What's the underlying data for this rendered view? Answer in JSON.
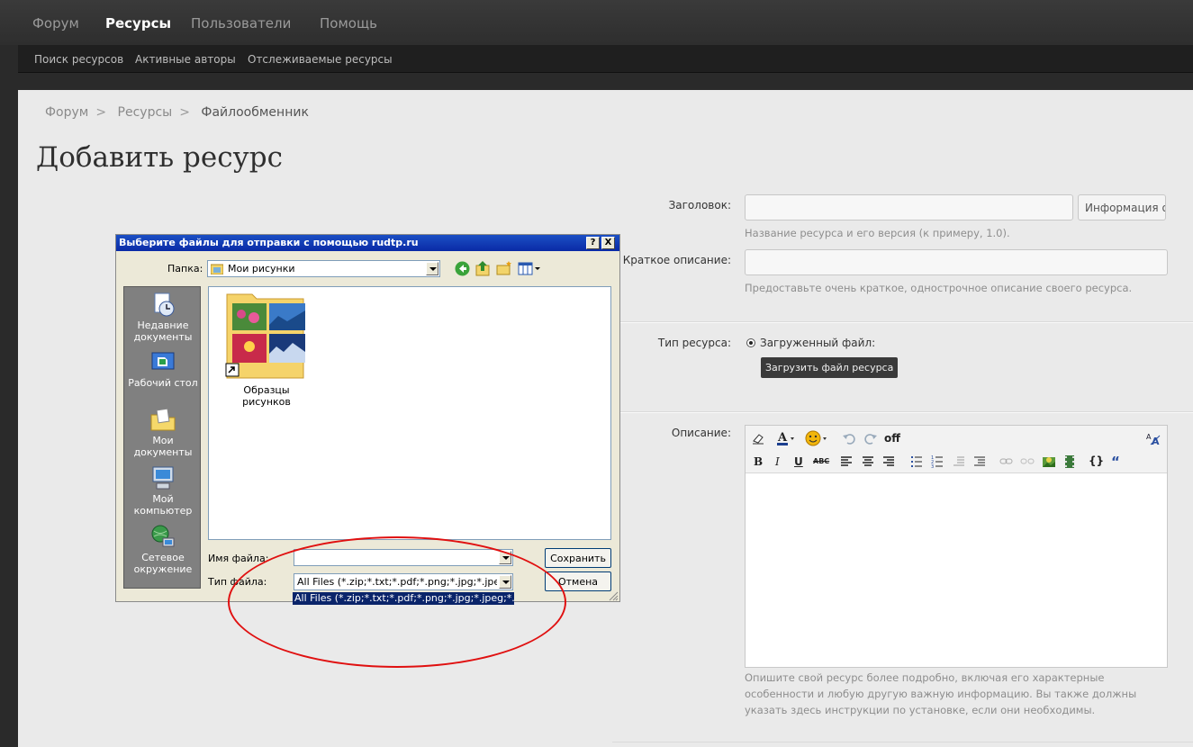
{
  "nav": {
    "tabs": [
      {
        "label": "Форум"
      },
      {
        "label": "Ресурсы"
      },
      {
        "label": "Пользователи"
      },
      {
        "label": "Помощь"
      }
    ],
    "subtabs": [
      {
        "label": "Поиск ресурсов"
      },
      {
        "label": "Активные авторы"
      },
      {
        "label": "Отслеживаемые ресурсы"
      }
    ]
  },
  "breadcrumb": [
    "Форум",
    "Ресурсы",
    "Файлообменник"
  ],
  "page_title": "Добавить ресурс",
  "form": {
    "title_label": "Заголовок:",
    "title_hint": "Название ресурса и его версия (к примеру, 1.0).",
    "info_button": "Информация о",
    "short_label": "Краткое описание:",
    "short_hint": "Предоставьте очень краткое, однострочное описание своего ресурса.",
    "type_label": "Тип ресурса:",
    "type_option": "Загруженный файл:",
    "upload_button": "Загрузить файл ресурса",
    "desc_label": "Описание:",
    "desc_hint": "Опишите свой ресурс более подробно, включая его характерные особенности и любую другую важную информацию. Вы также должны указать здесь инструкции по установке, если они необходимы.",
    "editor_off": "off"
  },
  "dialog": {
    "title": "Выберите файлы для отправки с помощью rudtp.ru",
    "help_btn": "?",
    "close_btn": "X",
    "folder_label": "Папка:",
    "folder_value": "Мои рисунки",
    "places": [
      {
        "label": "Недавние документы",
        "icon": "recent-documents-icon"
      },
      {
        "label": "Рабочий стол",
        "icon": "desktop-icon"
      },
      {
        "label": "Мои документы",
        "icon": "my-documents-icon"
      },
      {
        "label": "Мой компьютер",
        "icon": "my-computer-icon"
      },
      {
        "label": "Сетевое окружение",
        "icon": "network-icon"
      }
    ],
    "files": [
      {
        "label": "Образцы рисунков",
        "icon": "sample-pictures-folder-icon"
      }
    ],
    "filename_label": "Имя файла:",
    "filename_value": "",
    "filetype_label": "Тип файла:",
    "filetype_value": "All Files (*.zip;*.txt;*.pdf;*.png;*.jpg;*.jpeg;*.jpe;*.gif;*",
    "filetype_option": "All Files (*.zip;*.txt;*.pdf;*.png;*.jpg;*.jpeg;*.jpe;*.gif;*",
    "save_button": "Сохранить",
    "cancel_button": "Отмена"
  },
  "colors": {
    "annotation": "#e01010",
    "xp_titlebar": "#0a2aa6",
    "selection": "#0a246a"
  }
}
